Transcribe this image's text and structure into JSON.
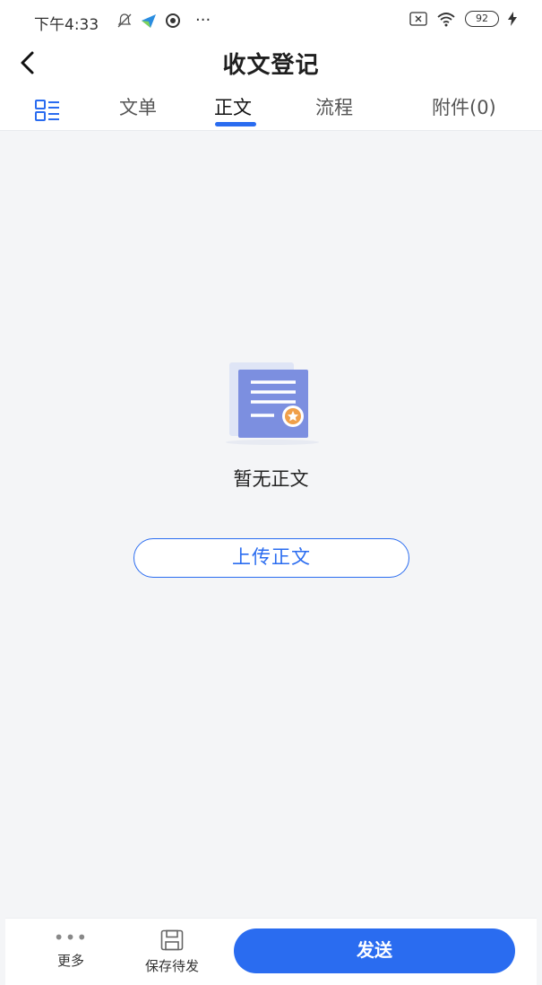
{
  "status_bar": {
    "time": "下午4:33",
    "dots": "···",
    "battery": "92"
  },
  "navbar": {
    "title": "收文登记"
  },
  "tabs": [
    {
      "label": "文单",
      "active": false
    },
    {
      "label": "正文",
      "active": true
    },
    {
      "label": "流程",
      "active": false
    },
    {
      "label": "附件(0)",
      "active": false
    }
  ],
  "empty_state": {
    "message": "暂无正文",
    "upload_label": "上传正文"
  },
  "bottom_bar": {
    "more_label": "更多",
    "save_label": "保存待发",
    "send_label": "发送"
  },
  "colors": {
    "accent": "#2a6cf0",
    "background": "#f4f5f7"
  }
}
